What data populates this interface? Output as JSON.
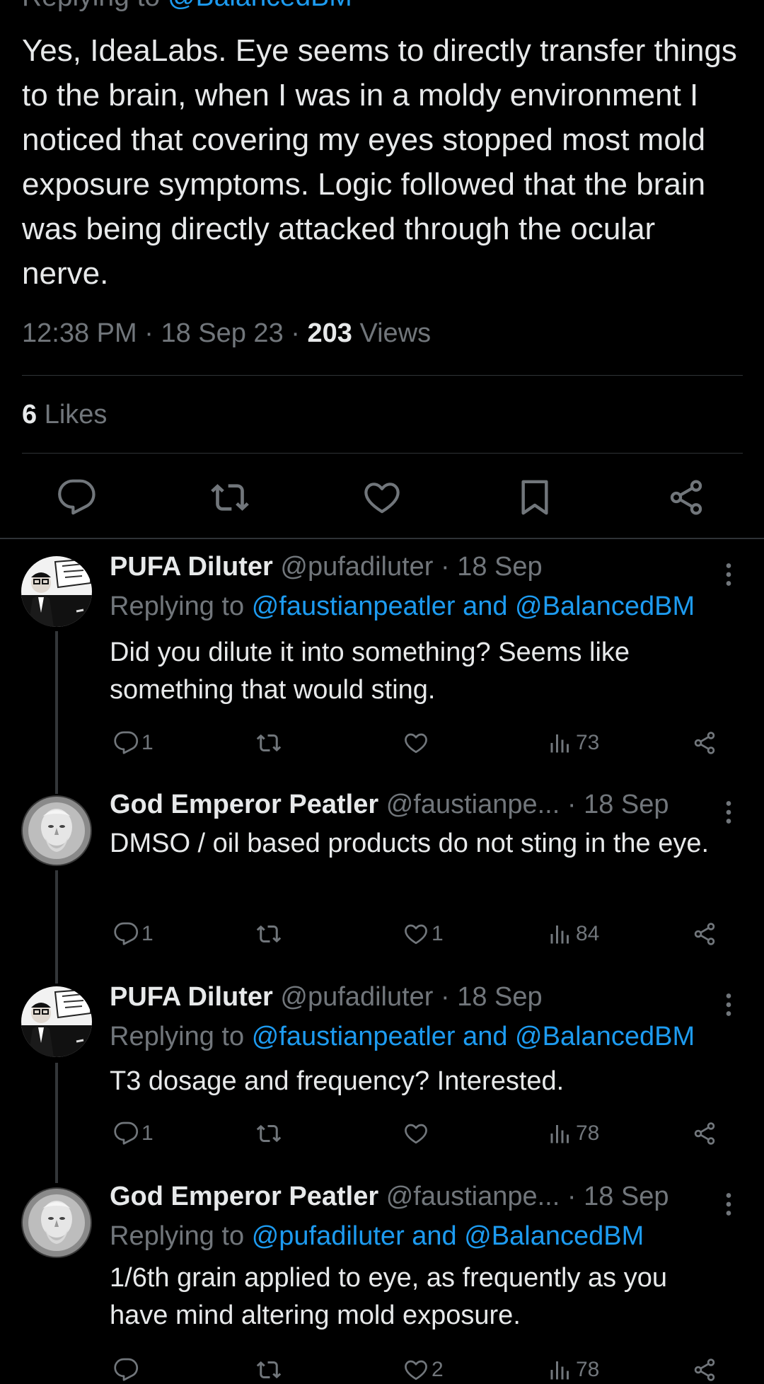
{
  "main_tweet": {
    "replying_prefix": "Replying to",
    "replying_handle": "@BalancedBM",
    "text": "Yes, IdeaLabs. Eye seems to directly transfer things to the brain, when I was in a moldy environment I noticed that covering my eyes stopped most mold exposure symptoms. Logic followed that the brain was being directly attacked through the ocular nerve.",
    "time": "12:38 PM",
    "date": "18 Sep 23",
    "views_count": "203",
    "views_label": "Views",
    "likes_count": "6",
    "likes_label": "Likes"
  },
  "replies": [
    {
      "name": "PUFA Diluter",
      "handle": "@pufadiluter",
      "date": "· 18 Sep",
      "replying_prefix": "Replying to",
      "replying_to": "@faustianpeatler and @BalancedBM",
      "text": "Did you dilute it into something? Seems like something that would sting.",
      "reply_count": "1",
      "retweet_count": "",
      "like_count": "",
      "view_count": "73"
    },
    {
      "name": "God Emperor Peatler",
      "handle": "@faustianpe...",
      "date": "· 18 Sep",
      "replying_prefix": "",
      "replying_to": "",
      "text": "DMSO / oil based products do not sting in the eye.",
      "reply_count": "1",
      "retweet_count": "",
      "like_count": "1",
      "view_count": "84"
    },
    {
      "name": "PUFA Diluter",
      "handle": "@pufadiluter",
      "date": "· 18 Sep",
      "replying_prefix": "Replying to",
      "replying_to": "@faustianpeatler and @BalancedBM",
      "text": "T3 dosage and frequency? Interested.",
      "reply_count": "1",
      "retweet_count": "",
      "like_count": "",
      "view_count": "78"
    },
    {
      "name": "God Emperor Peatler",
      "handle": "@faustianpe...",
      "date": "· 18 Sep",
      "replying_prefix": "Replying to",
      "replying_to": "@pufadiluter and @BalancedBM",
      "text": "1/6th grain applied to eye, as frequently as you have mind altering mold exposure.",
      "reply_count": "",
      "retweet_count": "",
      "like_count": "2",
      "view_count": "78"
    }
  ],
  "icons": {
    "reply": "reply-icon",
    "retweet": "retweet-icon",
    "like": "like-icon",
    "bookmark": "bookmark-icon",
    "share": "share-icon",
    "views": "views-icon",
    "more": "more-icon"
  },
  "colors": {
    "background": "#000000",
    "text": "#e7e9ea",
    "muted": "#71767b",
    "link": "#1d9bf0",
    "divider": "#2f3336"
  }
}
